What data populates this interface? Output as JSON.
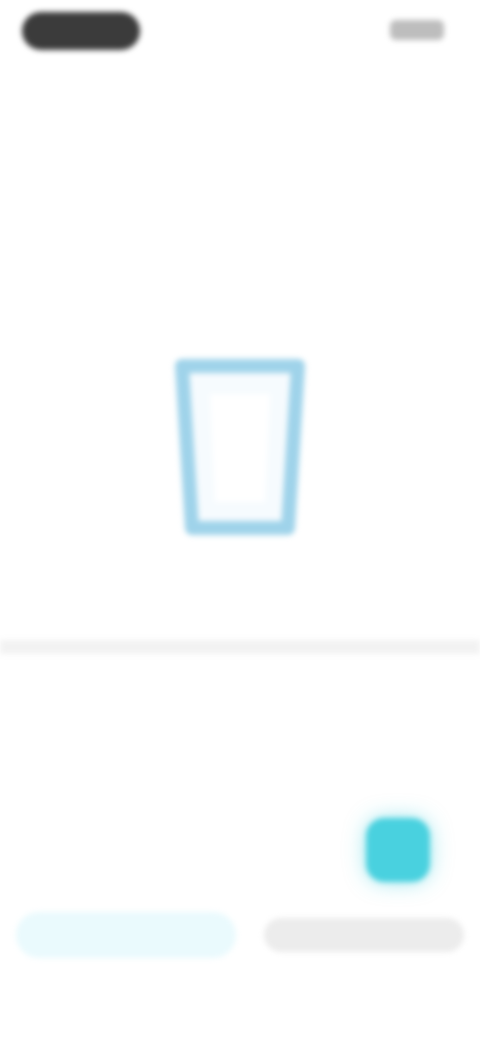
{
  "status_bar": {},
  "header": {
    "title": ""
  },
  "page": {
    "title": "",
    "subtitle": ""
  },
  "illustration": {
    "icon": "cup-icon",
    "caption": "",
    "sub_caption": ""
  },
  "section": {
    "title": "",
    "subtitle": ""
  },
  "fab": {
    "icon": "action-icon",
    "color": "#49d1df"
  },
  "bottom": {
    "left_tab_label": "",
    "right_tab_label": ""
  },
  "colors": {
    "accent": "#49d1df",
    "cup_stroke": "#9fd3ea"
  }
}
